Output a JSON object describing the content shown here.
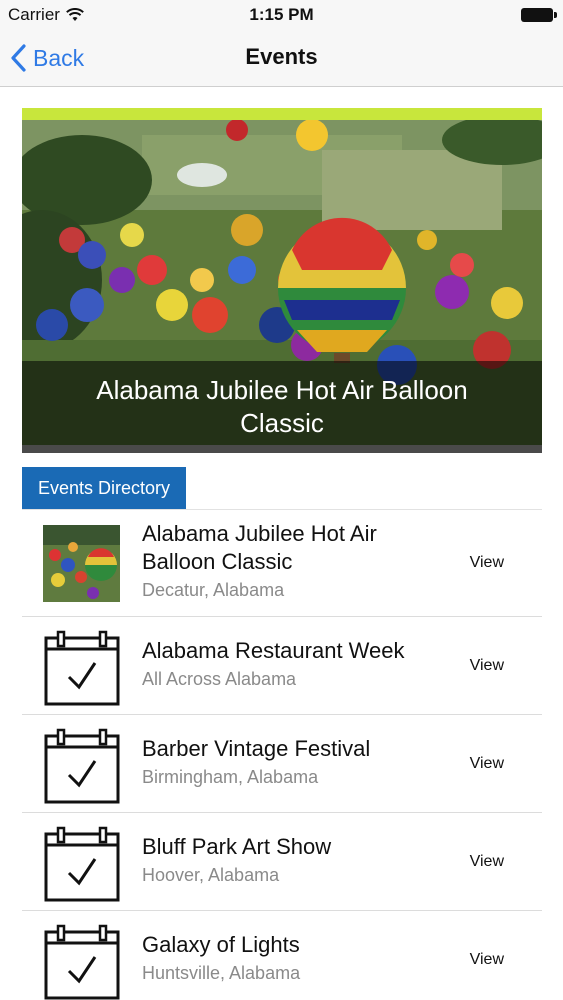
{
  "status_bar": {
    "carrier": "Carrier",
    "time": "1:15 PM"
  },
  "nav": {
    "back_label": "Back",
    "title": "Events"
  },
  "hero": {
    "caption": "Alabama Jubilee Hot Air Balloon Classic",
    "accent_color": "#c8e63c"
  },
  "directory": {
    "tab_label": "Events Directory",
    "tab_color": "#1a6ab5"
  },
  "events": [
    {
      "title": "Alabama Jubilee Hot Air Balloon Classic",
      "location": "Decatur, Alabama",
      "action": "View",
      "icon": "balloon-photo"
    },
    {
      "title": "Alabama Restaurant Week",
      "location": "All Across Alabama",
      "action": "View",
      "icon": "calendar-check-icon"
    },
    {
      "title": "Barber Vintage Festival",
      "location": "Birmingham, Alabama",
      "action": "View",
      "icon": "calendar-check-icon"
    },
    {
      "title": "Bluff Park Art Show",
      "location": "Hoover, Alabama",
      "action": "View",
      "icon": "calendar-check-icon"
    },
    {
      "title": "Galaxy of Lights",
      "location": "Huntsville, Alabama",
      "action": "View",
      "icon": "calendar-check-icon"
    }
  ]
}
